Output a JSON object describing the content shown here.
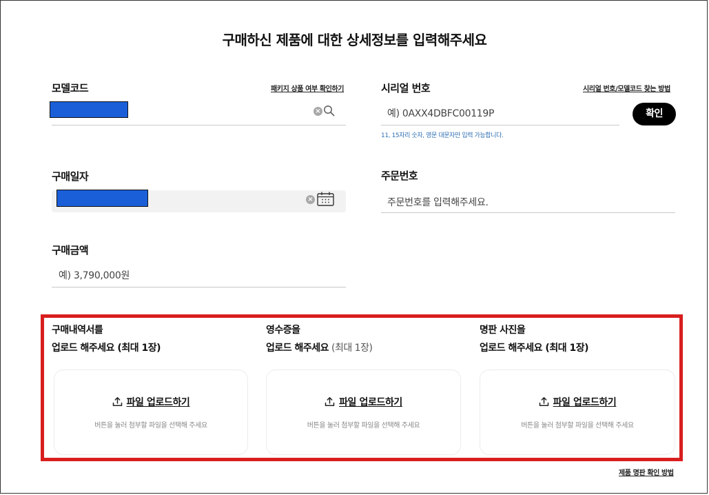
{
  "page_title": "구매하신 제품에 대한 상세정보를 입력해주세요",
  "model_code": {
    "label": "모델코드",
    "package_link": "패키지 상품 여부 확인하기",
    "value_redacted": true
  },
  "serial": {
    "label": "시리얼 번호",
    "find_link": "시리얼 번호/모델코드 찾는 방법",
    "placeholder": "예) 0AXX4DBFC00119P",
    "confirm_label": "확인",
    "hint": "11, 15자리 숫자, 영문 대문자만 입력 가능합니다."
  },
  "purchase_date": {
    "label": "구매일자",
    "value_redacted": true
  },
  "order_number": {
    "label": "주문번호",
    "placeholder": "주문번호를 입력해주세요."
  },
  "purchase_amount": {
    "label": "구매금액",
    "placeholder": "예) 3,790,000원"
  },
  "uploads": [
    {
      "title_line1": "구매내역서를",
      "title_line2_bold": "업로드 해주세요",
      "title_line2_suffix": " (최대 1장)",
      "button_label": "파일 업로드하기",
      "help_text": "버튼을 눌러 첨부할 파일을 선택해 주세요"
    },
    {
      "title_line1": "영수증을",
      "title_line2_bold": "업로드 해주세요",
      "title_line2_suffix": " (최대 1장)",
      "button_label": "파일 업로드하기",
      "help_text": "버튼을 눌러 첨부할 파일을 선택해 주세요"
    },
    {
      "title_line1": "명판 사진을",
      "title_line2_bold": "업로드 해주세요",
      "title_line2_suffix": " (최대 1장)",
      "button_label": "파일 업로드하기",
      "help_text": "버튼을 눌러 첨부할 파일을 선택해 주세요"
    }
  ],
  "nameplate_link": "제품 명판 확인 방법",
  "colors": {
    "highlight_border": "#d81e1e",
    "redaction": "#1a5fd8",
    "hint_text": "#2f6fb3",
    "button_bg": "#000000"
  }
}
